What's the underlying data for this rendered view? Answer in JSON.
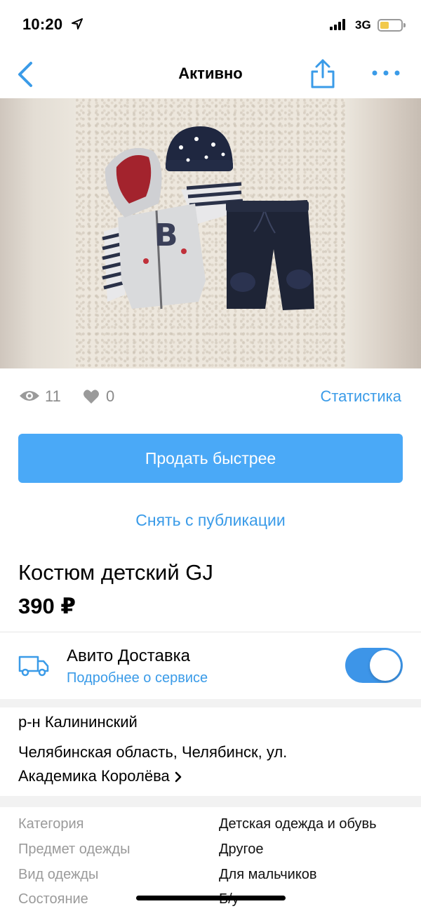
{
  "status_bar": {
    "time": "10:20",
    "network": "3G",
    "icons": [
      "location-arrow-icon",
      "signal-bars-icon",
      "battery-icon"
    ]
  },
  "nav": {
    "title": "Активно",
    "icons": [
      "chevron-left-icon",
      "share-icon",
      "more-dots-icon"
    ]
  },
  "stats": {
    "views": "11",
    "likes": "0",
    "statistics_link": "Статистика"
  },
  "actions": {
    "sell_faster": "Продать быстрее",
    "unpublish": "Снять с публикации"
  },
  "item": {
    "title": "Костюм детский GJ",
    "price": "390 ₽"
  },
  "delivery": {
    "title": "Авито Доставка",
    "link": "Подробнее о сервисе",
    "enabled": true
  },
  "address": {
    "district": "р-н Калининский",
    "line1": "Челябинская область, Челябинск, ул.",
    "line2": "Академика Королёва"
  },
  "params": [
    {
      "label": "Категория",
      "value": "Детская одежда и обувь"
    },
    {
      "label": "Предмет одежды",
      "value": "Другое"
    },
    {
      "label": "Вид одежды",
      "value": "Для мальчиков"
    },
    {
      "label": "Состояние",
      "value": "Б/у"
    }
  ],
  "colors": {
    "accent": "#4aa9f7",
    "link": "#3a9be8",
    "muted": "#8a8a8a"
  }
}
